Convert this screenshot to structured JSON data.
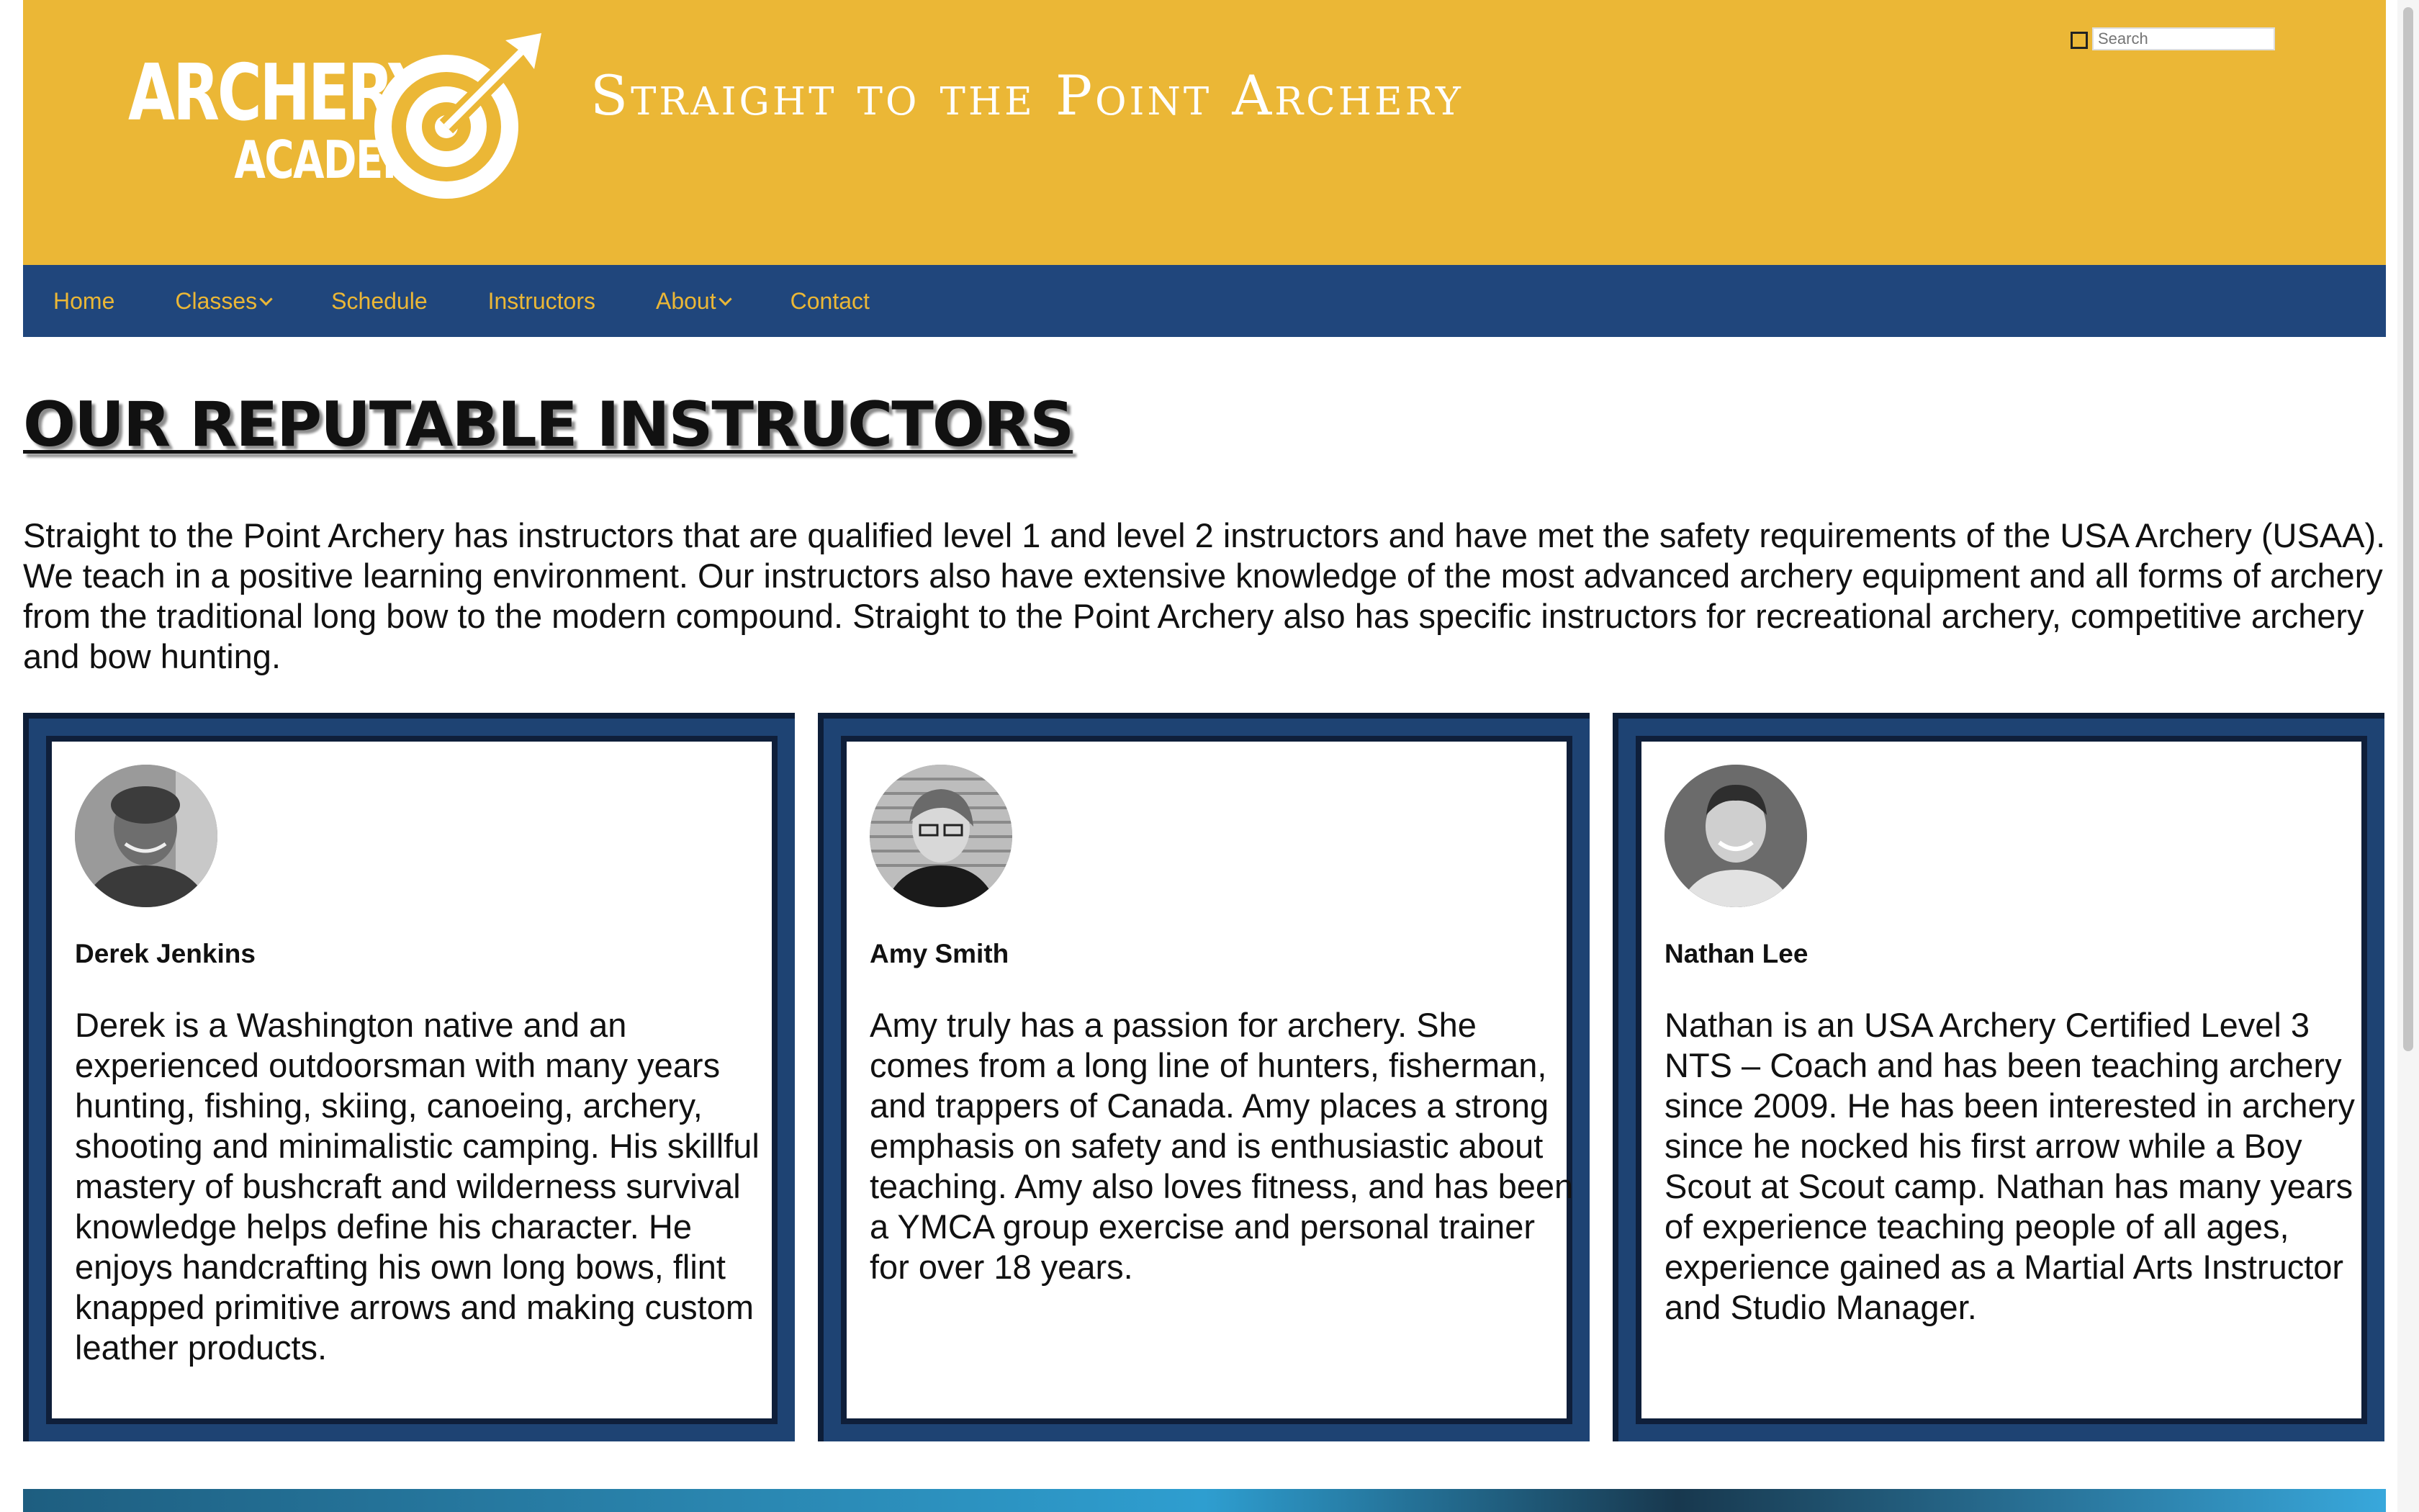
{
  "header": {
    "logo_line1": "ARCHERY",
    "logo_line2": "ACADEMY",
    "site_title": "Straight to the Point Archery",
    "search_placeholder": "Search"
  },
  "nav": {
    "items": [
      {
        "label": "Home",
        "has_dropdown": false
      },
      {
        "label": "Classes",
        "has_dropdown": true
      },
      {
        "label": "Schedule",
        "has_dropdown": false
      },
      {
        "label": "Instructors",
        "has_dropdown": false
      },
      {
        "label": "About",
        "has_dropdown": true
      },
      {
        "label": "Contact",
        "has_dropdown": false
      }
    ]
  },
  "main": {
    "title": "OUR REPUTABLE INSTRUCTORS",
    "intro": "Straight to the Point Archery has instructors that are qualified level 1 and level 2 instructors and have met the safety requirements of the USA Archery (USAA). We teach in a positive learning environment. Our instructors also have extensive knowledge of the most advanced archery equipment and all forms of archery from the traditional long bow to the modern compound. Straight to the Point Archery also has specific instructors for recreational archery, competitive archery and bow hunting."
  },
  "instructors": [
    {
      "name": "Derek Jenkins",
      "bio": "Derek is a Washington native and an experienced outdoorsman with many years hunting, fishing, skiing, canoeing, archery, shooting and minimalistic camping. His skillful mastery of bushcraft and wilderness survival knowledge helps define his character. He enjoys handcrafting his own long bows, flint knapped primitive arrows and making custom leather products."
    },
    {
      "name": "Amy Smith",
      "bio": "Amy truly has a passion for archery. She comes from a long line of hunters, fisherman, and trappers of Canada. Amy places a strong emphasis on safety and is enthusiastic about teaching. Amy also loves fitness, and has been a YMCA group exercise and personal trainer for over 18 years."
    },
    {
      "name": "Nathan Lee",
      "bio": "Nathan is an USA Archery Certified Level 3 NTS – Coach and has been teaching archery since 2009. He has been interested in archery since he nocked his first arrow while a Boy Scout at Scout camp. Nathan has many years of experience teaching people of all ages, experience gained as a Martial Arts Instructor and Studio Manager."
    }
  ],
  "colors": {
    "header_bg": "#EBB736",
    "nav_bg": "#20467C",
    "nav_text": "#EBB736",
    "card_border": "#1E4373"
  }
}
